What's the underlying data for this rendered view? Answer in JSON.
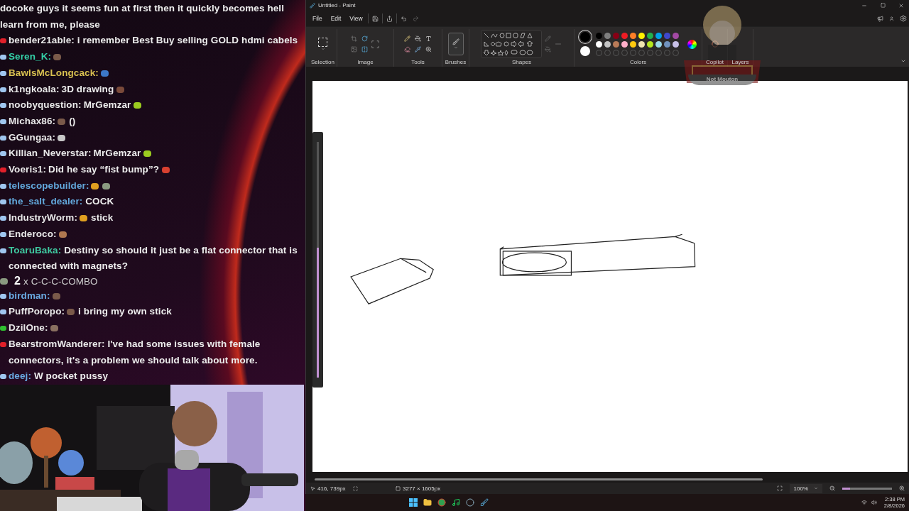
{
  "chat": {
    "messages": [
      {
        "kind": "continuation",
        "text": "docoke guys it seems fun at first then it quickly becomes hell learn from me, please"
      },
      {
        "kind": "chat",
        "badge": {
          "color": "#e0202a"
        },
        "user": {
          "name": "bender21able:",
          "color": "#e8e8e8"
        },
        "segments": [
          {
            "kind": "text",
            "text": "i remember Best Buy selling GOLD hdmi cabels"
          }
        ]
      },
      {
        "kind": "chat",
        "badge": {
          "color": "#9fc6ef"
        },
        "user": {
          "name": "Seren_K:",
          "color": "#34d0a8"
        },
        "segments": [
          {
            "kind": "emote",
            "color": "#7a5a4a"
          }
        ]
      },
      {
        "kind": "chat",
        "badge": {
          "color": "#9fc6ef"
        },
        "user": {
          "name": "BawlsMcLongcack:",
          "color": "#d8c050"
        },
        "segments": [
          {
            "kind": "emote",
            "color": "#3c78c8"
          }
        ]
      },
      {
        "kind": "chat",
        "badge": {
          "color": "#9fc6ef"
        },
        "user": {
          "name": "k1ngkoala:",
          "color": "#e8e8e8"
        },
        "segments": [
          {
            "kind": "text",
            "text": "3D drawing"
          },
          {
            "kind": "emote",
            "color": "#7a4a3a"
          }
        ]
      },
      {
        "kind": "chat",
        "badge": {
          "color": "#9fc6ef"
        },
        "user": {
          "name": "noobyquestion:",
          "color": "#e8e8e8"
        },
        "segments": [
          {
            "kind": "text",
            "text": "MrGemzar"
          },
          {
            "kind": "emote",
            "color": "#9ccc20"
          }
        ]
      },
      {
        "kind": "chat",
        "badge": {
          "color": "#9fc6ef"
        },
        "user": {
          "name": "Michax86:",
          "color": "#e8e8e8"
        },
        "segments": [
          {
            "kind": "emote",
            "color": "#7a5a4a"
          },
          {
            "kind": "text",
            "text": "()"
          }
        ]
      },
      {
        "kind": "chat",
        "badge": {
          "color": "#9fc6ef"
        },
        "user": {
          "name": "GGungaa:",
          "color": "#e8e8e8"
        },
        "segments": [
          {
            "kind": "emote",
            "color": "#c8c8c8"
          }
        ]
      },
      {
        "kind": "chat",
        "badge": {
          "color": "#9fc6ef"
        },
        "user": {
          "name": "Killian_Neverstar:",
          "color": "#e8e8e8"
        },
        "segments": [
          {
            "kind": "text",
            "text": "MrGemzar"
          },
          {
            "kind": "emote",
            "color": "#9ccc20"
          }
        ]
      },
      {
        "kind": "chat",
        "badge": {
          "color": "#e0202a"
        },
        "user": {
          "name": "Voeris1:",
          "color": "#e8e8e8"
        },
        "segments": [
          {
            "kind": "text",
            "text": "Did he say “fist bump”?"
          },
          {
            "kind": "emote",
            "color": "#d84030"
          }
        ]
      },
      {
        "kind": "chat",
        "badge": {
          "color": "#9fc6ef"
        },
        "user": {
          "name": "telescopebuilder:",
          "color": "#62a8dc"
        },
        "segments": [
          {
            "kind": "emote",
            "color": "#e0a020"
          },
          {
            "kind": "emote",
            "color": "#8a9a80"
          }
        ]
      },
      {
        "kind": "chat",
        "badge": {
          "color": "#9fc6ef"
        },
        "user": {
          "name": "the_salt_dealer:",
          "color": "#62a8dc"
        },
        "segments": [
          {
            "kind": "text",
            "text": "COCK"
          }
        ]
      },
      {
        "kind": "chat",
        "badge": {
          "color": "#9fc6ef"
        },
        "user": {
          "name": "IndustryWorm:",
          "color": "#e8e8e8"
        },
        "segments": [
          {
            "kind": "emote",
            "color": "#e0a020"
          },
          {
            "kind": "text",
            "text": "stick"
          }
        ]
      },
      {
        "kind": "chat",
        "badge": {
          "color": "#9fc6ef"
        },
        "user": {
          "name": "Enderoco:",
          "color": "#e8e8e8"
        },
        "segments": [
          {
            "kind": "emote",
            "color": "#b07850"
          }
        ]
      },
      {
        "kind": "chat",
        "badge": {
          "color": "#9fc6ef"
        },
        "user": {
          "name": "ToaruBaka:",
          "color": "#3fc9a0"
        },
        "segments": [
          {
            "kind": "text",
            "text": "Destiny so should it just be a flat connector that is connected with magnets?"
          }
        ]
      },
      {
        "kind": "combo",
        "count": "2",
        "times": "x",
        "label": "C-C-C-COMBO"
      },
      {
        "kind": "chat",
        "badge": {
          "color": "#9fc6ef"
        },
        "user": {
          "name": "birdman:",
          "color": "#6aaae2"
        },
        "segments": [
          {
            "kind": "emote",
            "color": "#7a5a4a"
          }
        ]
      },
      {
        "kind": "chat",
        "badge": {
          "color": "#9fc6ef"
        },
        "user": {
          "name": "PuffPoropo:",
          "color": "#e8e8e8"
        },
        "segments": [
          {
            "kind": "emote",
            "color": "#7a5a4a"
          },
          {
            "kind": "text",
            "text": "i bring my own stick"
          }
        ]
      },
      {
        "kind": "chat",
        "badge": {
          "color": "#30c030"
        },
        "user": {
          "name": "DzilOne:",
          "color": "#e8e8e8"
        },
        "segments": [
          {
            "kind": "emote",
            "color": "#8a7060"
          }
        ]
      },
      {
        "kind": "chat",
        "badge": {
          "color": "#e0202a"
        },
        "user": {
          "name": "BearstromWanderer:",
          "color": "#e8e8e8"
        },
        "segments": [
          {
            "kind": "text",
            "text": "I've had some issues with female connectors, it's a problem we should talk about more."
          }
        ]
      },
      {
        "kind": "chat",
        "badge": {
          "color": "#9fc6ef"
        },
        "user": {
          "name": "deej:",
          "color": "#6aaae2"
        },
        "segments": [
          {
            "kind": "text",
            "text": "W pocket pussy"
          }
        ]
      }
    ]
  },
  "paint": {
    "title": "Untitled - Paint",
    "menu": [
      "File",
      "Edit",
      "View"
    ],
    "groups": [
      "Selection",
      "Image",
      "Tools",
      "Brushes",
      "Shapes",
      "Colors",
      "Copilot",
      "Layers"
    ],
    "current_colors": [
      {
        "color": "#000000",
        "selected": true
      },
      {
        "color": "#ffffff",
        "selected": false
      }
    ],
    "palette": [
      {
        "color": "#000000"
      },
      {
        "color": "#7f7f7f"
      },
      {
        "color": "#880015"
      },
      {
        "color": "#ed1c24"
      },
      {
        "color": "#ff7f27"
      },
      {
        "color": "#fff200"
      },
      {
        "color": "#22b14c"
      },
      {
        "color": "#00a2e8"
      },
      {
        "color": "#3f48cc"
      },
      {
        "color": "#a349a4"
      },
      {
        "color": "#ffffff"
      },
      {
        "color": "#c3c3c3"
      },
      {
        "color": "#b97a57"
      },
      {
        "color": "#ffaec9"
      },
      {
        "color": "#ffc90e"
      },
      {
        "color": "#efe4b0"
      },
      {
        "color": "#b5e61d"
      },
      {
        "color": "#99d9ea"
      },
      {
        "color": "#7092be"
      },
      {
        "color": "#c8bfe7"
      }
    ],
    "overlay_name": "Not Mouton",
    "side_slider": {
      "level": 0.55
    },
    "status": {
      "cursor": "416, 739px",
      "size": "3277 × 1605px",
      "zoom": "100%",
      "zoom_slider": {
        "level": 0.15
      }
    }
  },
  "taskbar": {
    "time": "2:38 PM",
    "date": "2/8/2026"
  }
}
